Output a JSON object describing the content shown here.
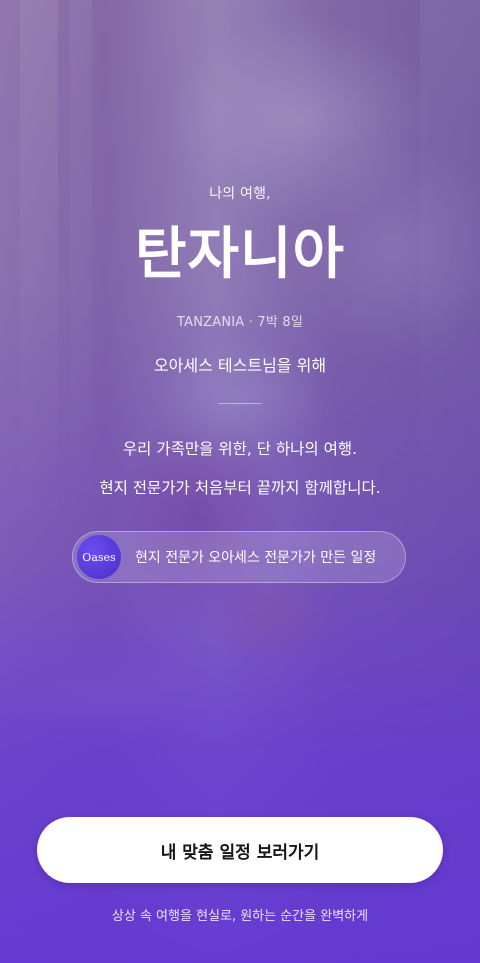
{
  "hero": {
    "eyebrow": "나의 여행,",
    "title": "탄자니아",
    "subtitle": "TANZANIA · 7박 8일",
    "for_user": "오아세스 테스트님을 위해"
  },
  "description": {
    "line1": "우리 가족만을 위한, 단 하나의 여행.",
    "line2": "현지 전문가가 처음부터 끝까지 함께합니다."
  },
  "badge": {
    "logo_text": "Oases",
    "text": "현지 전문가 오아세스 전문가가 만든 일정"
  },
  "cta": {
    "label": "내 맞춤 일정 보러가기"
  },
  "footer": {
    "tagline": "상상 속 여행을 현실로, 원하는 순간을 완벽하게"
  },
  "colors": {
    "accent_purple": "#6236d2",
    "button_bg": "#ffffff",
    "button_text": "#161616"
  }
}
